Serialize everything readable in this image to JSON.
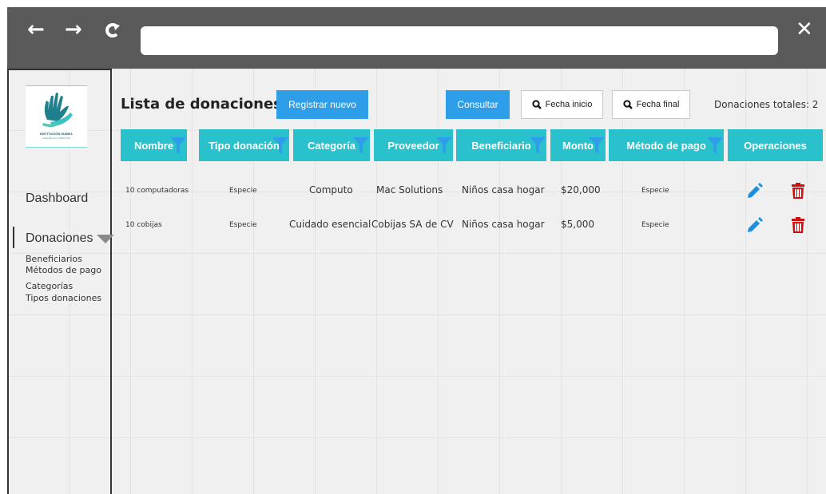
{
  "browser": {
    "back_icon": "arrow-left-icon",
    "forward_icon": "arrow-right-icon",
    "reload_icon": "reload-icon",
    "close_icon": "close-icon",
    "url": "",
    "back_glyph": "←",
    "forward_glyph": "→",
    "reload_glyph": "C",
    "close_glyph": "✕"
  },
  "sidebar": {
    "logo_line1": "INSTITUCIÓN ISABEL",
    "logo_line2": "Isabel Moreno Villalba IAP",
    "dashboard": "Dashboard",
    "donaciones": "Donaciones",
    "subitems": [
      "Beneficiarios",
      "Métodos de pago",
      "Categorías",
      "Tipos donaciones"
    ]
  },
  "header": {
    "title": "Lista de donaciones",
    "register_button": "Registrar nuevo",
    "consult_button": "Consultar",
    "date_start": "Fecha inicio",
    "date_end": "Fecha final",
    "total": "Donaciones totales: 2"
  },
  "table": {
    "columns": [
      "Nombre",
      "Tipo donación",
      "Categoría",
      "Proveedor",
      "Beneficiario",
      "Monto",
      "Método de pago",
      "Operaciones"
    ],
    "rows": [
      [
        "10 computadoras",
        "Especie",
        "Computo",
        "Mac Solutions",
        "Niños casa hogar",
        "$20,000",
        "Especie"
      ],
      [
        "10 cobijas",
        "Especie",
        "Cuidado esencial",
        "Cobijas SA de CV",
        "Niños casa hogar",
        "$5,000",
        "Especie"
      ]
    ]
  },
  "colors": {
    "header_bg": "#29c2cc",
    "filter_icon": "#2f9ee8",
    "primary_button": "#2f9ee8",
    "edit_icon": "#1a8fe0",
    "delete_icon": "#d01010"
  }
}
